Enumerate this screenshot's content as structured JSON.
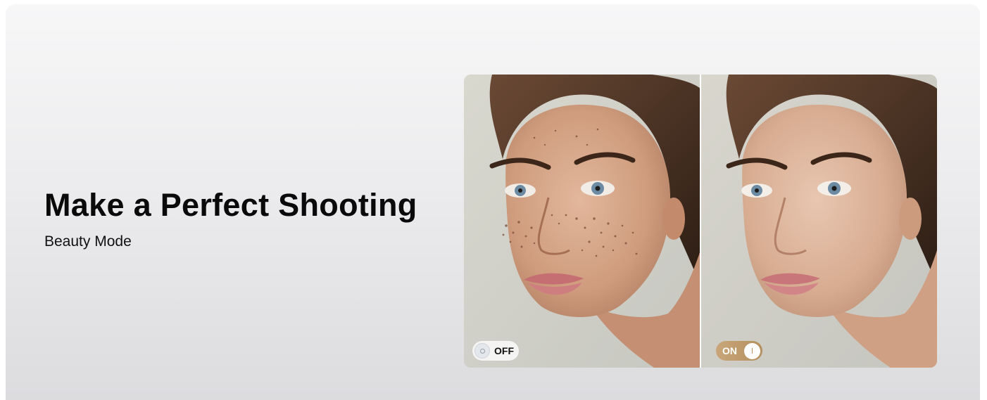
{
  "hero": {
    "title": "Make a Perfect Shooting",
    "subtitle": "Beauty Mode"
  },
  "comparison": {
    "before": {
      "toggle_label": "OFF",
      "icon": "toggle-off-icon"
    },
    "after": {
      "toggle_label": "ON",
      "icon": "toggle-on-icon"
    }
  },
  "colors": {
    "background_top": "#f7f7f8",
    "background_bottom": "#dcdcdf",
    "text": "#0a0a0a",
    "toggle_on_accent": "#c9a679",
    "toggle_off_bg": "#f5f5f5"
  }
}
